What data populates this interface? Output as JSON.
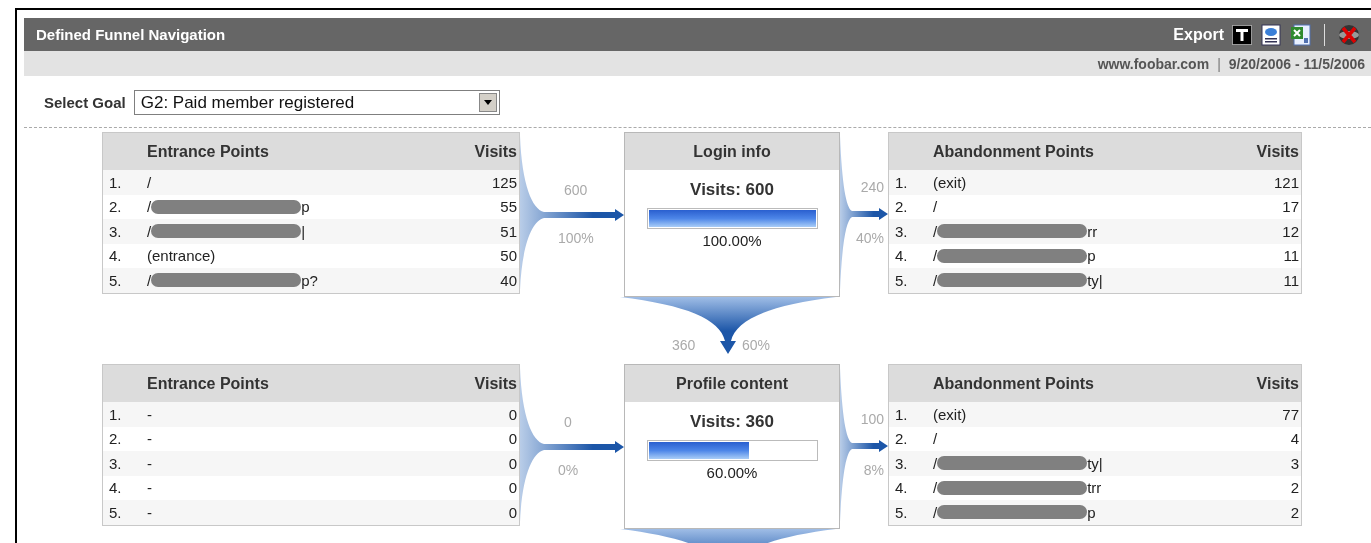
{
  "window": {
    "title": "Defined Funnel Navigation"
  },
  "export": {
    "label": "Export"
  },
  "subheader": {
    "site": "www.foobar.com",
    "separator": "|",
    "date_range": "9/20/2006 - 11/5/2006"
  },
  "goal_select": {
    "label": "Select Goal",
    "value": "G2: Paid member registered"
  },
  "steps": [
    {
      "name": "Login info",
      "visits": "Visits: 600",
      "level": 1.0,
      "percent": "100.00%",
      "entrance": {
        "title": "Entrance Points",
        "visits_header": "Visits",
        "count": "600",
        "percent": "100%",
        "rows": [
          {
            "index": "1.",
            "path": "/",
            "visits": "125"
          },
          {
            "index": "2.",
            "path": "/",
            "redacted": true,
            "tail": "p",
            "visits": "55"
          },
          {
            "index": "3.",
            "path": "/",
            "redacted": true,
            "tail": "|",
            "visits": "51"
          },
          {
            "index": "4.",
            "path": "(entrance)",
            "visits": "50"
          },
          {
            "index": "5.",
            "path": "/",
            "redacted": true,
            "tail": "p?",
            "visits": "40"
          }
        ]
      },
      "abandonment": {
        "title": "Abandonment Points",
        "visits_header": "Visits",
        "count": "240",
        "percent": "40%",
        "rows": [
          {
            "index": "1.",
            "path": "(exit)",
            "visits": "121"
          },
          {
            "index": "2.",
            "path": "/",
            "visits": "17"
          },
          {
            "index": "3.",
            "path": "/",
            "redacted": true,
            "tail": "rr",
            "visits": "12"
          },
          {
            "index": "4.",
            "path": "/",
            "redacted": true,
            "tail": "p",
            "visits": "11"
          },
          {
            "index": "5.",
            "path": "/",
            "redacted": true,
            "tail": "ty|",
            "visits": "11"
          }
        ]
      },
      "next": {
        "count": "360",
        "percent": "60%"
      }
    },
    {
      "name": "Profile content",
      "visits": "Visits: 360",
      "level": 0.6,
      "percent": "60.00%",
      "entrance": {
        "title": "Entrance Points",
        "visits_header": "Visits",
        "count": "0",
        "percent": "0%",
        "rows": [
          {
            "index": "1.",
            "path": "-",
            "visits": "0"
          },
          {
            "index": "2.",
            "path": "-",
            "visits": "0"
          },
          {
            "index": "3.",
            "path": "-",
            "visits": "0"
          },
          {
            "index": "4.",
            "path": "-",
            "visits": "0"
          },
          {
            "index": "5.",
            "path": "-",
            "visits": "0"
          }
        ]
      },
      "abandonment": {
        "title": "Abandonment Points",
        "visits_header": "Visits",
        "count": "100",
        "percent": "8%",
        "rows": [
          {
            "index": "1.",
            "path": "(exit)",
            "visits": "77"
          },
          {
            "index": "2.",
            "path": "/",
            "visits": "4"
          },
          {
            "index": "3.",
            "path": "/",
            "redacted": true,
            "tail": "ty|",
            "visits": "3"
          },
          {
            "index": "4.",
            "path": "/",
            "redacted": true,
            "tail": "trr",
            "visits": "2"
          },
          {
            "index": "5.",
            "path": "/",
            "redacted": true,
            "tail": "p",
            "visits": "2"
          }
        ]
      }
    }
  ]
}
